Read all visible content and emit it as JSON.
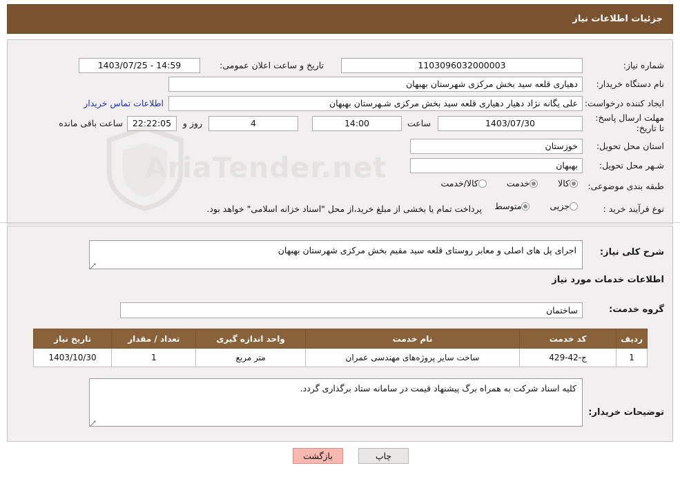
{
  "header": {
    "title": "جزئیات اطلاعات نیاز"
  },
  "top": {
    "labels": {
      "need_number": "شماره نیاز:",
      "buyer_org": "نام دستگاه خریدار:",
      "requester": "ایجاد کننده درخواست:",
      "deadline": "مهلت ارسال پاسخ: تا تاریخ:",
      "announce_date": "تاریخ و ساعت اعلان عمومی:",
      "province": "استان محل تحویل:",
      "city": "شـهر محل تحویل:",
      "category": "طبقه بندی موضوعی:",
      "purchase_type": "نوع فرآیند خرید :",
      "hour": "ساعت",
      "days_remaining": "روز و",
      "remaining_suffix": "ساعت باقی مانده"
    },
    "values": {
      "need_number": "1103096032000003",
      "buyer_org": "دهیاری قلعه سید بخش مرکزی شهرستان بهبهان",
      "requester": "علی یگانه نژاد دهیار دهیاری قلعه سید بخش مرکزی شـهرستان بهبهان",
      "contact_link": "اطلاعات تماس خریدار",
      "deadline_date": "1403/07/30",
      "deadline_hour": "14:00",
      "days_remaining": "4",
      "countdown": "22:22:05",
      "announce_datetime": "14:59 - 1403/07/25",
      "province": "خوزستان",
      "city": "بهبهان"
    },
    "category_options": [
      {
        "label": "کالا",
        "selected": true
      },
      {
        "label": "خدمت",
        "selected": true
      },
      {
        "label": "کالا/خدمت",
        "selected": false
      }
    ],
    "purchase_options": [
      {
        "label": "جزیی",
        "selected": false
      },
      {
        "label": "متوسط",
        "selected": true
      }
    ],
    "purchase_note": "پرداخت تمام یا بخشی از مبلغ خرید،از محل \"اسناد خزانه اسلامی\" خواهد بود."
  },
  "bottom": {
    "labels": {
      "summary": "شرح کلی نیاز:",
      "services_info": "اطلاعات خدمات مورد نیاز",
      "service_group": "گروه خدمت:",
      "buyer_notes": "توضیحات خریدار:"
    },
    "values": {
      "summary": "اجرای پل های اصلی و معابر روستای قلعه سید مقیم  بخش مرکزی شهرستان بهبهان",
      "service_group": "ساختمان",
      "buyer_notes": "کلیه اسناد شرکت به همراه برگ پیشنهاد قیمت در سامانه ستاد برگذاری گردد."
    },
    "table": {
      "headers": [
        "ردیف",
        "کد خدمت",
        "نام خدمت",
        "واحد اندازه گیری",
        "تعداد / مقدار",
        "تاریخ نیاز"
      ],
      "rows": [
        [
          "1",
          "ج-42-429",
          "ساخت سایر پروژه‌های مهندسی عمران",
          "متر مربع",
          "1",
          "1403/10/30"
        ]
      ]
    }
  },
  "footer": {
    "print_label": "چاپ",
    "back_label": "بازگشت"
  },
  "watermark": {
    "text": "AriaTender.net"
  },
  "colors": {
    "header_brown": "#7a5230",
    "table_header": "#8a6239",
    "panel_bg": "#f1efef",
    "link_blue": "#1f2fbf",
    "back_btn": "#f6b8b0"
  }
}
